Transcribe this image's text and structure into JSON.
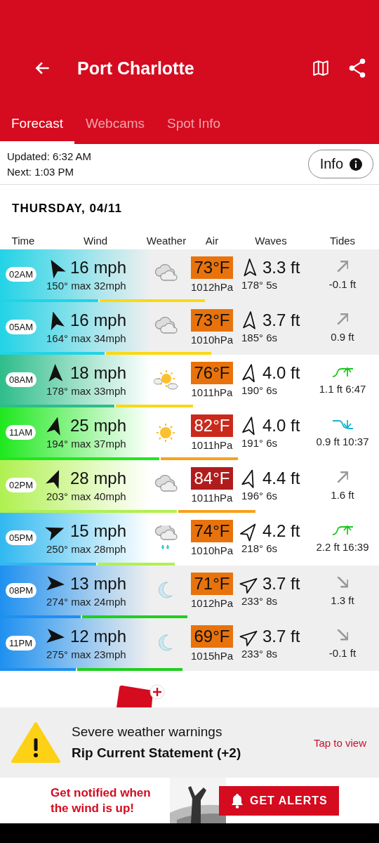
{
  "header": {
    "title": "Port Charlotte"
  },
  "tabs": [
    {
      "label": "Forecast",
      "selected": true
    },
    {
      "label": "Webcams",
      "selected": false
    },
    {
      "label": "Spot Info",
      "selected": false
    }
  ],
  "update": {
    "updated": "Updated: 6:32 AM",
    "next": "Next: 1:03 PM",
    "info_button": "Info"
  },
  "day": "THURSDAY, 04/11",
  "columns": [
    "Time",
    "Wind",
    "Weather",
    "Air",
    "Waves",
    "Tides"
  ],
  "rows": [
    {
      "time": "02AM",
      "night": true,
      "wind": {
        "color": "#22d3e6",
        "speed": "16",
        "unit": "mph",
        "dir": "150°",
        "gust": "max 32mph"
      },
      "weather": {
        "kind": "cloudy"
      },
      "air": {
        "value": "73°F",
        "color": "#e8730c"
      },
      "pressure": "1012hPa",
      "wave_height": "3.3 ft",
      "wave_dir": "178°",
      "wave_period": "5s",
      "tide": {
        "kind": "rising",
        "value": "-0.1 ft"
      },
      "wind_bar": {
        "color": "#22d3e6",
        "level": 0.26
      },
      "wave_bar": {
        "color": "#fad814"
      }
    },
    {
      "time": "05AM",
      "night": true,
      "wind": {
        "color": "#22d3e6",
        "speed": "16",
        "unit": "mph",
        "dir": "164°",
        "gust": "max 34mph"
      },
      "weather": {
        "kind": "cloudy"
      },
      "air": {
        "value": "73°F",
        "color": "#e8730c"
      },
      "pressure": "1010hPa",
      "wave_height": "3.7 ft",
      "wave_dir": "185°",
      "wave_period": "6s",
      "tide": {
        "kind": "rising",
        "value": "0.9 ft"
      },
      "wind_bar": {
        "color": "#22d3e6",
        "level": 0.275
      },
      "wave_bar": {
        "color": "#fad814"
      }
    },
    {
      "time": "08AM",
      "night": false,
      "wind": {
        "color": "#2ebd8a",
        "speed": "18",
        "unit": "mph",
        "dir": "178°",
        "gust": "max 33mph"
      },
      "weather": {
        "kind": "partly_sunny"
      },
      "air": {
        "value": "76°F",
        "color": "#e8730c"
      },
      "pressure": "1011hPa",
      "wave_height": "4.0 ft",
      "wave_dir": "190°",
      "wave_period": "6s",
      "tide": {
        "kind": "high",
        "value": "1.1 ft 6:47"
      },
      "wind_bar": {
        "color": "#2ebd8a",
        "level": 0.302
      },
      "wave_bar": {
        "color": "#fad814"
      }
    },
    {
      "time": "11AM",
      "night": false,
      "wind": {
        "color": "#1ee81e",
        "speed": "25",
        "unit": "mph",
        "dir": "194°",
        "gust": "max 37mph"
      },
      "weather": {
        "kind": "sunny"
      },
      "air": {
        "value": "82°F",
        "color": "#c92a1c"
      },
      "pressure": "1011hPa",
      "wave_height": "4.0 ft",
      "wave_dir": "191°",
      "wave_period": "6s",
      "tide": {
        "kind": "low",
        "value": "0.9 ft 10:37"
      },
      "wind_bar": {
        "color": "#1ee81e",
        "level": 0.42
      },
      "wave_bar": {
        "color": "#f7a21b"
      }
    },
    {
      "time": "02PM",
      "night": false,
      "wind": {
        "color": "#b0f050",
        "speed": "28",
        "unit": "mph",
        "dir": "203°",
        "gust": "max 40mph"
      },
      "weather": {
        "kind": "cloudy"
      },
      "air": {
        "value": "84°F",
        "color": "#b01c1c"
      },
      "pressure": "1011hPa",
      "wave_height": "4.4 ft",
      "wave_dir": "196°",
      "wave_period": "6s",
      "tide": {
        "kind": "rising",
        "value": "1.6 ft"
      },
      "wind_bar": {
        "color": "#b0f050",
        "level": 0.466
      },
      "wave_bar": {
        "color": "#f7a21b"
      }
    },
    {
      "time": "05PM",
      "night": false,
      "wind": {
        "color": "#30b8f0",
        "speed": "15",
        "unit": "mph",
        "dir": "250°",
        "gust": "max 28mph"
      },
      "weather": {
        "kind": "rain"
      },
      "air": {
        "value": "74°F",
        "color": "#e8730c"
      },
      "pressure": "1010hPa",
      "wave_height": "4.2 ft",
      "wave_dir": "218°",
      "wave_period": "6s",
      "tide": {
        "kind": "high",
        "value": "2.2 ft 16:39"
      },
      "wind_bar": {
        "color": "#30b8f0",
        "level": 0.254
      },
      "wave_bar": {
        "color": "#b0f050"
      }
    },
    {
      "time": "08PM",
      "night": true,
      "wind": {
        "color": "#1e90f0",
        "speed": "13",
        "unit": "mph",
        "dir": "274°",
        "gust": "max 24mph"
      },
      "weather": {
        "kind": "moon"
      },
      "air": {
        "value": "71°F",
        "color": "#e8730c"
      },
      "pressure": "1012hPa",
      "wave_height": "3.7 ft",
      "wave_dir": "233°",
      "wave_period": "8s",
      "tide": {
        "kind": "falling",
        "value": "1.3 ft"
      },
      "wind_bar": {
        "color": "#1e90f0",
        "level": 0.213
      },
      "wave_bar": {
        "color": "#1ed01e"
      }
    },
    {
      "time": "11PM",
      "night": true,
      "wind": {
        "color": "#1e90f0",
        "speed": "12",
        "unit": "mph",
        "dir": "275°",
        "gust": "max 23mph"
      },
      "weather": {
        "kind": "moon"
      },
      "air": {
        "value": "69°F",
        "color": "#e8730c"
      },
      "pressure": "1015hPa",
      "wave_height": "3.7 ft",
      "wave_dir": "233°",
      "wave_period": "8s",
      "tide": {
        "kind": "falling",
        "value": "-0.1 ft"
      },
      "wind_bar": {
        "color": "#1e90f0",
        "level": 0.2
      },
      "wave_bar": {
        "color": "#1ed01e"
      }
    }
  ],
  "warning": {
    "title": "Severe weather warnings",
    "detail": "Rip Current Statement (+2)",
    "action": "Tap to view"
  },
  "ad": {
    "text": "Get notified when the wind is up!",
    "button": "GET ALERTS"
  }
}
